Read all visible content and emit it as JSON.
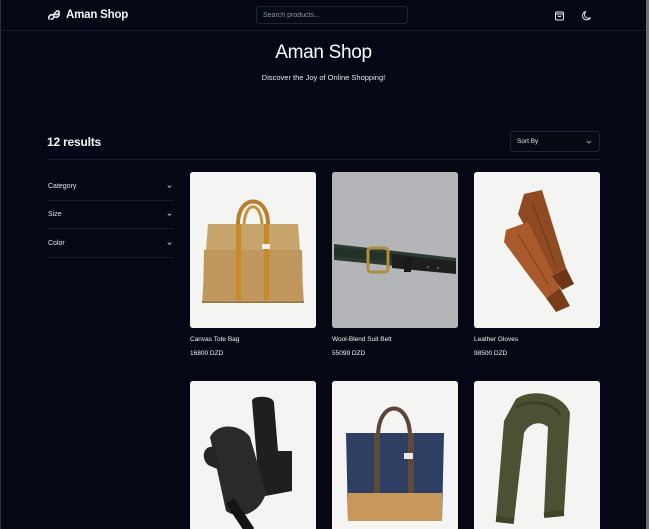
{
  "navbar": {
    "brand": "Aman Shop",
    "search_placeholder": "Search products...",
    "cart_icon": "shopping-bag-icon",
    "theme_icon": "moon-icon"
  },
  "hero": {
    "title": "Aman Shop",
    "subtitle": "Discover the Joy of Online Shopping!"
  },
  "results": {
    "count_label": "12 results",
    "sort_label": "Sort By"
  },
  "filters": [
    {
      "label": "Category"
    },
    {
      "label": "Size"
    },
    {
      "label": "Color"
    }
  ],
  "products": [
    {
      "name": "Canvas Tote Bag",
      "price": "16800 DZD",
      "image": "canvas-tote-bag"
    },
    {
      "name": "Wool-Blend Suit Belt",
      "price": "55099 DZD",
      "image": "belt"
    },
    {
      "name": "Leather Gloves",
      "price": "98500 DZD",
      "image": "leather-gloves"
    },
    {
      "name": "",
      "price": "",
      "image": "mittens"
    },
    {
      "name": "",
      "price": "",
      "image": "navy-tote-bag"
    },
    {
      "name": "",
      "price": "",
      "image": "wool-scarf"
    }
  ],
  "colors": {
    "background": "#050814",
    "border": "#1f2633",
    "text": "#f3f4f6"
  }
}
